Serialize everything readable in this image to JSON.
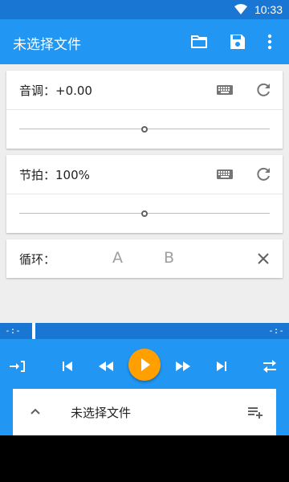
{
  "status_bar": {
    "time": "10:33",
    "wifi_icon": "wifi-icon"
  },
  "app_bar": {
    "title": "未选择文件",
    "actions": [
      "open-folder-icon",
      "save-icon",
      "more-vert-icon"
    ]
  },
  "pitch": {
    "label": "音调：+0.00",
    "value": 0.5
  },
  "tempo": {
    "label": "节拍：100%",
    "value": 0.5
  },
  "loop": {
    "label": "循环：",
    "a": "A",
    "b": "B"
  },
  "progress": {
    "left_time": "-:-",
    "right_time": "-:-",
    "value": 0
  },
  "file_panel": {
    "name": "未选择文件"
  },
  "colors": {
    "primary": "#2196f3",
    "primary_dark": "#1976d2",
    "accent": "#ffa000",
    "icon_gray": "#757575",
    "background": "#eeeeee"
  }
}
